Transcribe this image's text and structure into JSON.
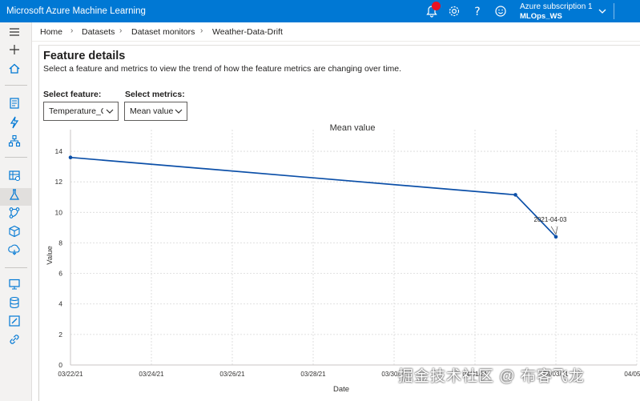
{
  "app": {
    "title": "Microsoft Azure Machine Learning",
    "subscription": "Azure subscription 1",
    "workspace": "MLOps_WS",
    "colors": {
      "brand": "#0078d4",
      "notification": "#e81123",
      "series": "#0b4fa8"
    }
  },
  "topbar_icons": [
    "bell-icon",
    "gear-icon",
    "help-icon",
    "smiley-icon",
    "chevron-down-icon"
  ],
  "nav_icons": [
    "hamburger-icon",
    "plus-icon",
    "home-icon",
    "notebook-icon",
    "automl-icon",
    "designer-icon",
    "datasets-icon",
    "experiments-icon",
    "pipelines-icon",
    "models-icon",
    "endpoints-icon",
    "compute-icon",
    "datastores-icon",
    "labeling-icon",
    "linked-services-icon"
  ],
  "breadcrumb": {
    "items": [
      "Home",
      "Datasets",
      "Dataset monitors"
    ],
    "current": "Weather-Data-Drift"
  },
  "page": {
    "title": "Feature details",
    "description": "Select a feature and metrics to view the trend of how the feature metrics are changing over time."
  },
  "controls": {
    "feature_label": "Select feature:",
    "feature_value": "Temperature_C",
    "metrics_label": "Select metrics:",
    "metrics_value": "Mean value"
  },
  "chart_data": {
    "type": "line",
    "title": "Mean value",
    "xlabel": "Date",
    "ylabel": "Value",
    "x_ticks": [
      "03/22/21",
      "03/24/21",
      "03/26/21",
      "03/28/21",
      "03/30/21",
      "04/01/21",
      "04/03/21",
      "04/05/21"
    ],
    "y_ticks": [
      "0",
      "2",
      "4",
      "6",
      "8",
      "10",
      "12",
      "14"
    ],
    "xlim": [
      "2021-03-22",
      "2021-04-05"
    ],
    "ylim": [
      0,
      15
    ],
    "grid": true,
    "series": [
      {
        "x": [
          "2021-03-22",
          "2021-04-02",
          "2021-04-03"
        ],
        "y": [
          13.6,
          11.15,
          8.4
        ]
      }
    ],
    "annotation": {
      "text": "2021-04-03",
      "x": "2021-04-03",
      "y": 8.4
    }
  },
  "watermark": "掘金技术社区 @ 布客飞龙"
}
